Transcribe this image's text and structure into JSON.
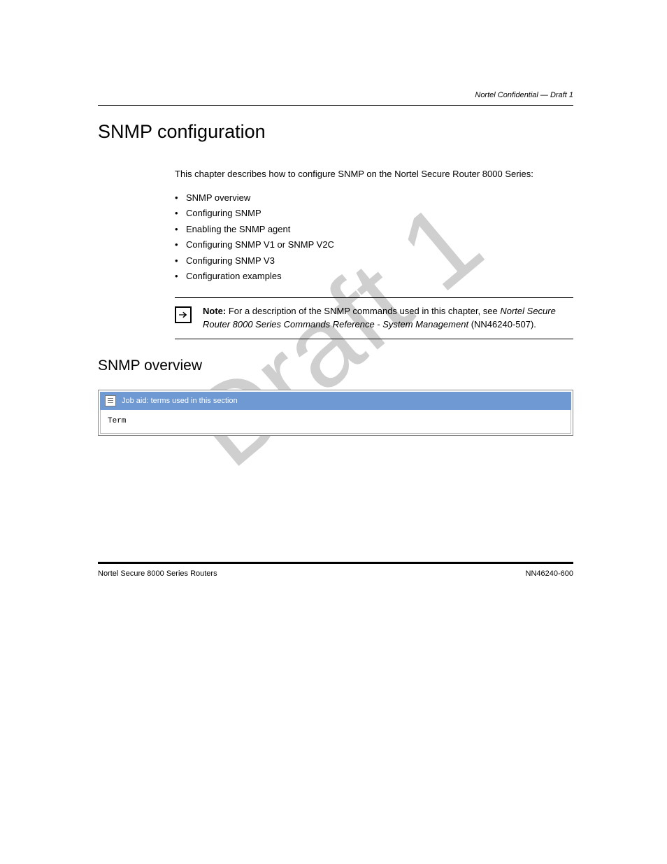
{
  "running_head": "Nortel Confidential — Draft 1",
  "chapter_title": "SNMP configuration",
  "intro": "This chapter describes how to configure SNMP on the Nortel Secure Router 8000 Series:",
  "bullets": [
    "SNMP overview",
    "Configuring SNMP",
    "Enabling the SNMP agent",
    "Configuring SNMP V1 or SNMP V2C",
    "Configuring SNMP V3",
    "Configuration examples"
  ],
  "note": {
    "label": "Note:",
    "text_before": "For a description of the SNMP commands used in this chapter, see ",
    "xref": "Nortel Secure Router 8000 Series Commands Reference - System Management",
    "text_after": " (NN46240-507)."
  },
  "section_title": "SNMP overview",
  "codebox": {
    "header": "Job aid: terms used in this section",
    "body": "Term"
  },
  "watermark": "Draft 1",
  "footer": {
    "left": "Nortel Secure 8000 Series Routers",
    "right": "NN46240-600"
  }
}
